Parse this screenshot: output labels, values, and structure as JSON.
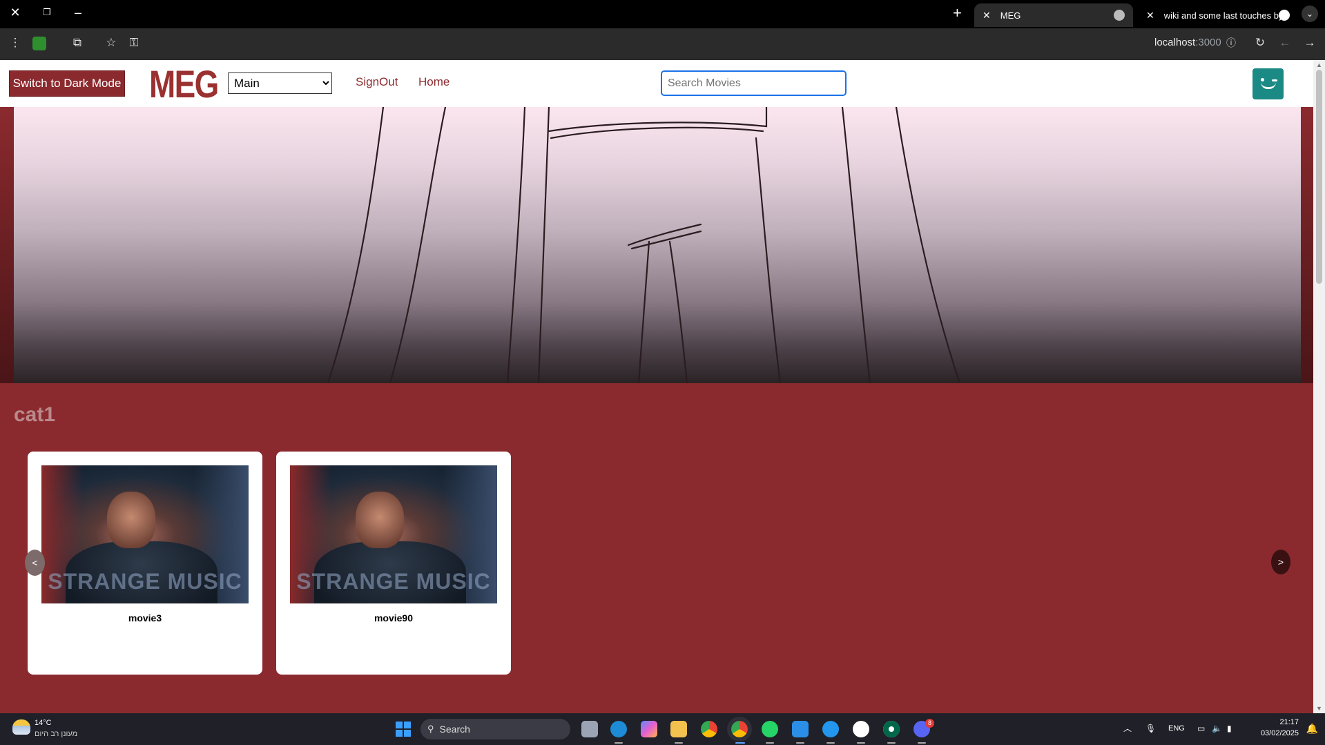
{
  "browser": {
    "tabs": [
      {
        "title": "MEG",
        "active": true
      },
      {
        "title": "wiki and some last touches by",
        "active": false
      }
    ],
    "url_host": "localhost",
    "url_port": ":3000"
  },
  "page": {
    "dark_mode_label": "Switch to Dark Mode",
    "logo": "MEG",
    "profile_select": {
      "selected": "Main"
    },
    "nav_links": [
      "SignOut",
      "Home"
    ],
    "search": {
      "placeholder": "Search Movies",
      "value": ""
    },
    "category": {
      "title": "cat1",
      "movies": [
        {
          "title": "movie3",
          "poster_text": "STRANGE MUSIC"
        },
        {
          "title": "movie90",
          "poster_text": "STRANGE MUSIC"
        }
      ],
      "prev_label": "<",
      "next_label": ">"
    },
    "colors": {
      "accent": "#8b2a2e",
      "logo": "#9b3030",
      "avatar": "#1b8a85"
    }
  },
  "taskbar": {
    "weather_temp": "14°C",
    "weather_desc": "מעונן רב היום",
    "search_label": "Search",
    "language": "ENG",
    "time": "21:17",
    "date": "03/02/2025",
    "discord_badge": "8"
  }
}
